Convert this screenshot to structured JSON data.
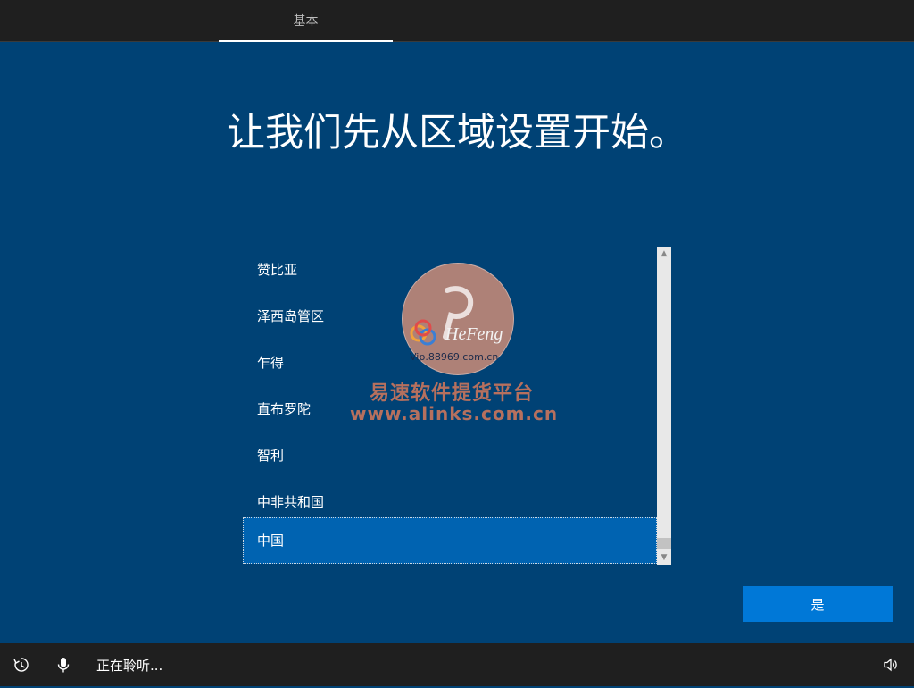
{
  "header": {
    "tabs": [
      {
        "label": "基本",
        "active": true
      }
    ]
  },
  "main": {
    "heading": "让我们先从区域设置开始。",
    "regions": [
      {
        "label": "赞比亚",
        "selected": false
      },
      {
        "label": "泽西岛管区",
        "selected": false
      },
      {
        "label": "乍得",
        "selected": false
      },
      {
        "label": "直布罗陀",
        "selected": false
      },
      {
        "label": "智利",
        "selected": false
      },
      {
        "label": "中非共和国",
        "selected": false
      },
      {
        "label": "中国",
        "selected": true
      }
    ],
    "confirm_label": "是"
  },
  "watermark": {
    "brand": "HeFeng",
    "url": "Vip.88969.com.cn",
    "line1": "易速软件提货平台",
    "line2": "www.alinks.com.cn"
  },
  "footer": {
    "status": "正在聆听...",
    "icons": [
      "ease-of-access-icon",
      "microphone-icon",
      "volume-icon"
    ]
  },
  "colors": {
    "background": "#004275",
    "bar": "#1f1f1f",
    "selected": "#0063b1",
    "accent": "#0078d7"
  }
}
